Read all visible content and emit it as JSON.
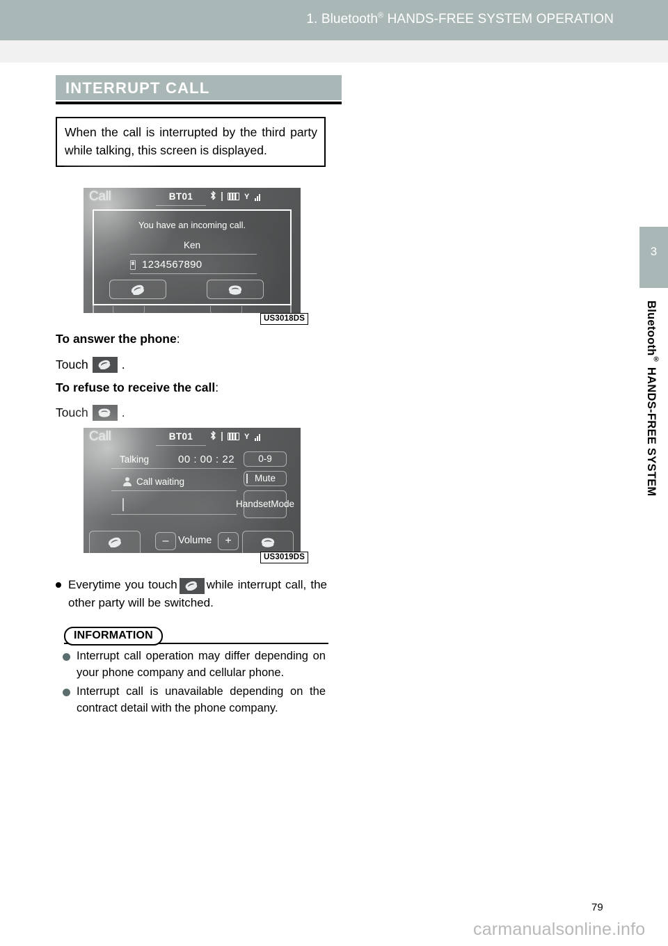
{
  "header": {
    "chapter_prefix": "1. Bluetooth",
    "registered_mark": "®",
    "title_rest": " HANDS-FREE SYSTEM OPERATION"
  },
  "sidebar": {
    "chapter_number": "3",
    "vertical_title_part1": "Bluetooth",
    "vertical_title_mark": "®",
    "vertical_title_part2": " HANDS-FREE SYSTEM"
  },
  "section": {
    "title": "INTERRUPT CALL",
    "intro": "When the call is interrupted by the third party while talking, this screen is displayed."
  },
  "figure_incoming": {
    "tag": "US3018DS",
    "call_label": "Call",
    "device_name": "BT01",
    "message": "You have an incoming call.",
    "caller_name": "Ken",
    "phone_number": "1234567890",
    "answer_button_icon": "phone-answer-icon",
    "refuse_button_icon": "phone-hangup-icon",
    "status_icons": [
      "bluetooth-icon",
      "battery-icon",
      "signal-icon"
    ]
  },
  "figure_talking": {
    "tag": "US3019DS",
    "call_label": "Call",
    "device_name": "BT01",
    "status_label": "Talking",
    "elapsed_time": "00 : 00 : 22",
    "call_waiting_label": "Call waiting",
    "button_keypad": "0-9",
    "button_mute": "Mute",
    "button_handset_line1": "Handset",
    "button_handset_line2": "Mode",
    "volume_label": "Volume",
    "volume_minus": "–",
    "volume_plus": "+",
    "answer_button_icon": "phone-answer-icon",
    "hangup_button_icon": "phone-hangup-icon",
    "status_icons": [
      "bluetooth-icon",
      "battery-icon",
      "signal-icon"
    ]
  },
  "instructions": {
    "answer_heading": "To answer the phone",
    "answer_heading_colon": ":",
    "answer_touch_prefix": "Touch",
    "answer_touch_suffix": ".",
    "refuse_heading": "To refuse to receive the call",
    "refuse_heading_colon": ":",
    "refuse_touch_prefix": "Touch",
    "refuse_touch_suffix": "."
  },
  "bullet_note": {
    "text_before": "Everytime you touch",
    "text_after": "while interrupt call, the other party will be switched."
  },
  "information": {
    "label": "INFORMATION",
    "items": [
      "Interrupt call operation may differ depending on your phone company and cellular phone.",
      "Interrupt call is unavailable depending on the contract detail with the phone company."
    ]
  },
  "footer": {
    "page_number": "79",
    "watermark": "carmanualsonline.info"
  },
  "colors": {
    "header_band": "#a9b7b6",
    "subheader_band": "#f0f1f0",
    "section_title_bar": "#a9b7b6",
    "info_bullet": "#5b6d6d",
    "watermark": "#b8b8b8"
  }
}
